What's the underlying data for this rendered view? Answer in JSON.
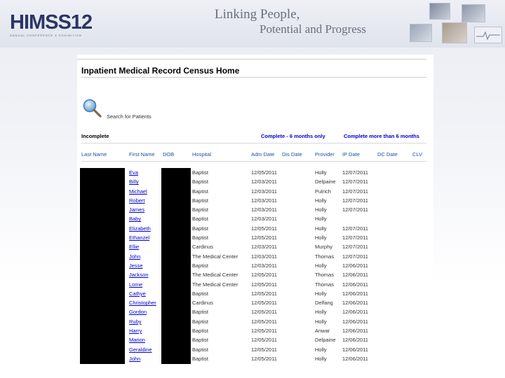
{
  "slide": {
    "logo_text": "HIMSS12",
    "logo_tagline": "ANNUAL CONFERENCE & EXHIBITION",
    "tagline_line1": "Linking People,",
    "tagline_line2": "Potential and Progress"
  },
  "app": {
    "title": "Inpatient Medical Record Census Home",
    "search_link": "Search for Patients",
    "tabs": [
      {
        "label": "Incomplete",
        "active": true
      },
      {
        "label": "Complete - 6 months only",
        "active": false
      },
      {
        "label": "Complete more than 6 months",
        "active": false
      }
    ],
    "columns": [
      "Last Name",
      "First Name",
      "DOB",
      "Hospital",
      "Adm Date",
      "Dis Date",
      "Provider",
      "IP Date",
      "DC Date",
      "CLV"
    ],
    "rows": [
      {
        "first": "Eva",
        "hospital": "Baptist",
        "adm": "12/05/2011",
        "provider": "Holly",
        "ip_date": "12/07/2011"
      },
      {
        "first": "Billy",
        "hospital": "Baptist",
        "adm": "12/03/2011",
        "provider": "Delpaine",
        "ip_date": "12/07/2011"
      },
      {
        "first": "Michael",
        "hospital": "Baptist",
        "adm": "12/03/2011",
        "provider": "Pulrich",
        "ip_date": "12/07/2011"
      },
      {
        "first": "Robert",
        "hospital": "Baptist",
        "adm": "12/03/2011",
        "provider": "Holly",
        "ip_date": "12/07/2011"
      },
      {
        "first": "James",
        "hospital": "Baptist",
        "adm": "12/03/2011",
        "provider": "Holly",
        "ip_date": "12/07/2011"
      },
      {
        "first": "Baby",
        "hospital": "Baptist",
        "adm": "12/03/2011",
        "provider": "Holly",
        "ip_date": ""
      },
      {
        "first": "Elizabeth",
        "hospital": "Baptist",
        "adm": "12/05/2011",
        "provider": "Holly",
        "ip_date": "12/07/2011"
      },
      {
        "first": "Ethanzel",
        "hospital": "Baptist",
        "adm": "12/05/2011",
        "provider": "Holly",
        "ip_date": "12/07/2011"
      },
      {
        "first": "Ellie",
        "hospital": "Cardinus",
        "adm": "12/03/2011",
        "provider": "Murphy",
        "ip_date": "12/07/2011"
      },
      {
        "first": "John",
        "hospital": "The Medical Center",
        "adm": "12/03/2011",
        "provider": "Thomas",
        "ip_date": "12/07/2011"
      },
      {
        "first": "Jesse",
        "hospital": "Baptist",
        "adm": "12/03/2011",
        "provider": "Holly",
        "ip_date": "12/06/2011"
      },
      {
        "first": "Jackson",
        "hospital": "The Medical Center",
        "adm": "12/05/2011",
        "provider": "Thomas",
        "ip_date": "12/06/2011"
      },
      {
        "first": "Lorne",
        "hospital": "The Medical Center",
        "adm": "12/05/2011",
        "provider": "Thomas",
        "ip_date": "12/06/2011"
      },
      {
        "first": "Cathye",
        "hospital": "Baptist",
        "adm": "12/05/2011",
        "provider": "Holly",
        "ip_date": "12/06/2011"
      },
      {
        "first": "Christopher",
        "hospital": "Cardinus",
        "adm": "12/05/2011",
        "provider": "Delfang",
        "ip_date": "12/06/2011"
      },
      {
        "first": "Gordon",
        "hospital": "Baptist",
        "adm": "12/05/2011",
        "provider": "Holly",
        "ip_date": "12/06/2011"
      },
      {
        "first": "Ruby",
        "hospital": "Baptist",
        "adm": "12/05/2011",
        "provider": "Holly",
        "ip_date": "12/06/2011"
      },
      {
        "first": "Harry",
        "hospital": "Baptist",
        "adm": "12/05/2011",
        "provider": "Anwar",
        "ip_date": "12/06/2011"
      },
      {
        "first": "Marion",
        "hospital": "Baptist",
        "adm": "12/05/2011",
        "provider": "Delpaine",
        "ip_date": "12/06/2011"
      },
      {
        "first": "Geraldine",
        "hospital": "Baptist",
        "adm": "12/05/2011",
        "provider": "Holly",
        "ip_date": "12/06/2011"
      },
      {
        "first": "John",
        "hospital": "Baptist",
        "adm": "12/05/2011",
        "provider": "Holly",
        "ip_date": "12/06/2011"
      }
    ]
  },
  "colors": {
    "link": "#0000cc",
    "header_link": "#1f4fa8",
    "logo": "#2a3566"
  },
  "icons": {
    "search": "magnifier-icon"
  }
}
